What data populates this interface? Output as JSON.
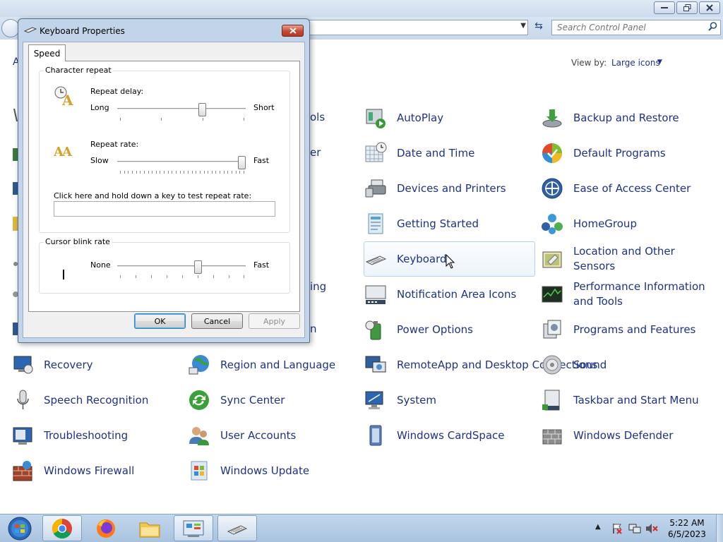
{
  "control_panel": {
    "search_placeholder": "Search Control Panel",
    "adjust_prefix": "A",
    "view_by_label": "View by:",
    "view_by_value": "Large icons",
    "partial_labels": [
      "ols",
      "er",
      "ing",
      "n"
    ],
    "items": [
      {
        "label": "AutoPlay",
        "icon": "autoplay-icon"
      },
      {
        "label": "Backup and Restore",
        "icon": "backup-restore-icon"
      },
      {
        "label": "Date and Time",
        "icon": "date-time-icon"
      },
      {
        "label": "Default Programs",
        "icon": "default-programs-icon"
      },
      {
        "label": "Devices and Printers",
        "icon": "devices-printers-icon"
      },
      {
        "label": "Ease of Access Center",
        "icon": "ease-of-access-icon"
      },
      {
        "label": "Getting Started",
        "icon": "getting-started-icon"
      },
      {
        "label": "HomeGroup",
        "icon": "homegroup-icon"
      },
      {
        "label": "Keyboard",
        "icon": "keyboard-icon"
      },
      {
        "label": "Location and Other Sensors",
        "icon": "location-sensors-icon"
      },
      {
        "label": "Notification Area Icons",
        "icon": "notification-area-icon"
      },
      {
        "label": "Performance Information and Tools",
        "icon": "performance-icon"
      },
      {
        "label": "Power Options",
        "icon": "power-options-icon"
      },
      {
        "label": "Programs and Features",
        "icon": "programs-features-icon"
      },
      {
        "label": "Recovery",
        "icon": "recovery-icon"
      },
      {
        "label": "Region and Language",
        "icon": "region-language-icon"
      },
      {
        "label": "RemoteApp and Desktop Connections",
        "icon": "remoteapp-icon"
      },
      {
        "label": "Sound",
        "icon": "sound-icon"
      },
      {
        "label": "Speech Recognition",
        "icon": "speech-recognition-icon"
      },
      {
        "label": "Sync Center",
        "icon": "sync-center-icon"
      },
      {
        "label": "System",
        "icon": "system-icon"
      },
      {
        "label": "Taskbar and Start Menu",
        "icon": "taskbar-start-icon"
      },
      {
        "label": "Troubleshooting",
        "icon": "troubleshooting-icon"
      },
      {
        "label": "User Accounts",
        "icon": "user-accounts-icon"
      },
      {
        "label": "Windows CardSpace",
        "icon": "cardspace-icon"
      },
      {
        "label": "Windows Defender",
        "icon": "defender-icon"
      },
      {
        "label": "Windows Firewall",
        "icon": "firewall-icon"
      },
      {
        "label": "Windows Update",
        "icon": "windows-update-icon"
      }
    ]
  },
  "dialog": {
    "title": "Keyboard Properties",
    "tab": "Speed",
    "character_repeat": {
      "group_title": "Character repeat",
      "repeat_delay_label": "Repeat delay:",
      "delay_min": "Long",
      "delay_max": "Short",
      "delay_value_fraction": 0.67,
      "repeat_rate_label": "Repeat rate:",
      "rate_min": "Slow",
      "rate_max": "Fast",
      "rate_value_fraction": 1.0,
      "test_label": "Click here and hold down a key to test repeat rate:",
      "test_value": ""
    },
    "cursor_blink": {
      "group_title": "Cursor blink rate",
      "min": "None",
      "max": "Fast",
      "value_fraction": 0.64
    },
    "buttons": {
      "ok": "OK",
      "cancel": "Cancel",
      "apply": "Apply"
    }
  },
  "taskbar": {
    "apps": [
      "start-orb-icon",
      "chrome-icon",
      "firefox-icon",
      "file-explorer-icon",
      "control-panel-icon",
      "keyboard-icon"
    ],
    "clock_time": "5:22 AM",
    "clock_date": "6/5/2023"
  },
  "colors": {
    "link": "#1e3287",
    "dialog_frame": "#c2d4ea",
    "taskbar": "#b6cde5",
    "close_button": "#c74a32"
  }
}
